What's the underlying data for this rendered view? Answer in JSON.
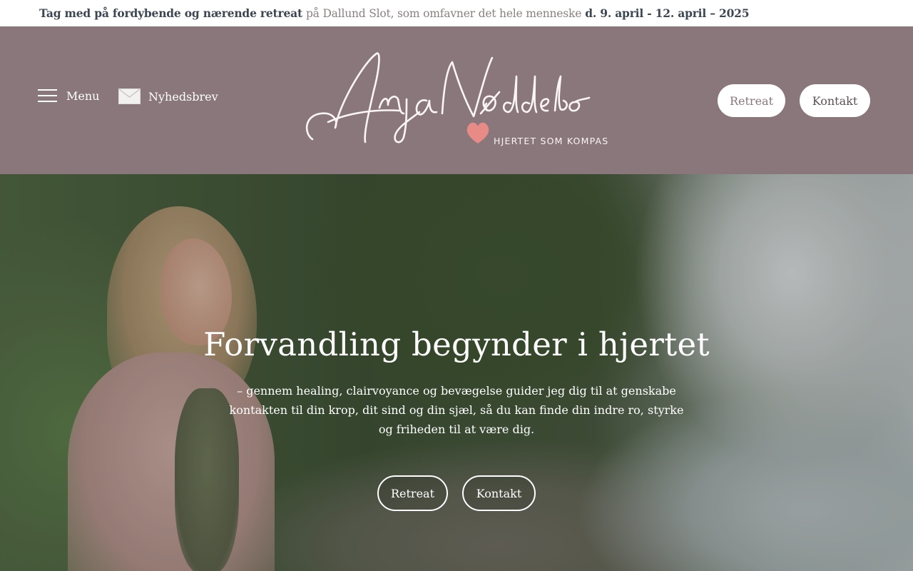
{
  "announcement": {
    "lead": "Tag med på fordybende og nærende retreat",
    "middle": "på Dallund Slot, som omfavner det hele menneske",
    "dates": "d. 9. april - 12. april – 2025"
  },
  "header": {
    "menu_label": "Menu",
    "newsletter_label": "Nyhedsbrev",
    "logo": {
      "name": "AnjaNøddebo",
      "tagline": "HJERTET SOM KOMPAS"
    },
    "buttons": {
      "retreat": "Retreat",
      "kontakt": "Kontakt"
    }
  },
  "hero": {
    "title": "Forvandling begynder i hjertet",
    "text": "– gennem healing, clairvoyance og bevægelse guider jeg dig til at genskabe kontakten til din krop, dit sind og din sjæl, så du kan finde din indre ro, styrke og friheden til at være dig.",
    "buttons": {
      "retreat": "Retreat",
      "kontakt": "Kontakt"
    }
  },
  "colors": {
    "header_bg": "#8a777b",
    "announcement_bold": "#3d4752",
    "heart": "#e88a86"
  },
  "icons": {
    "menu": "hamburger-icon",
    "newsletter": "envelope-icon",
    "heart": "heart-icon"
  }
}
